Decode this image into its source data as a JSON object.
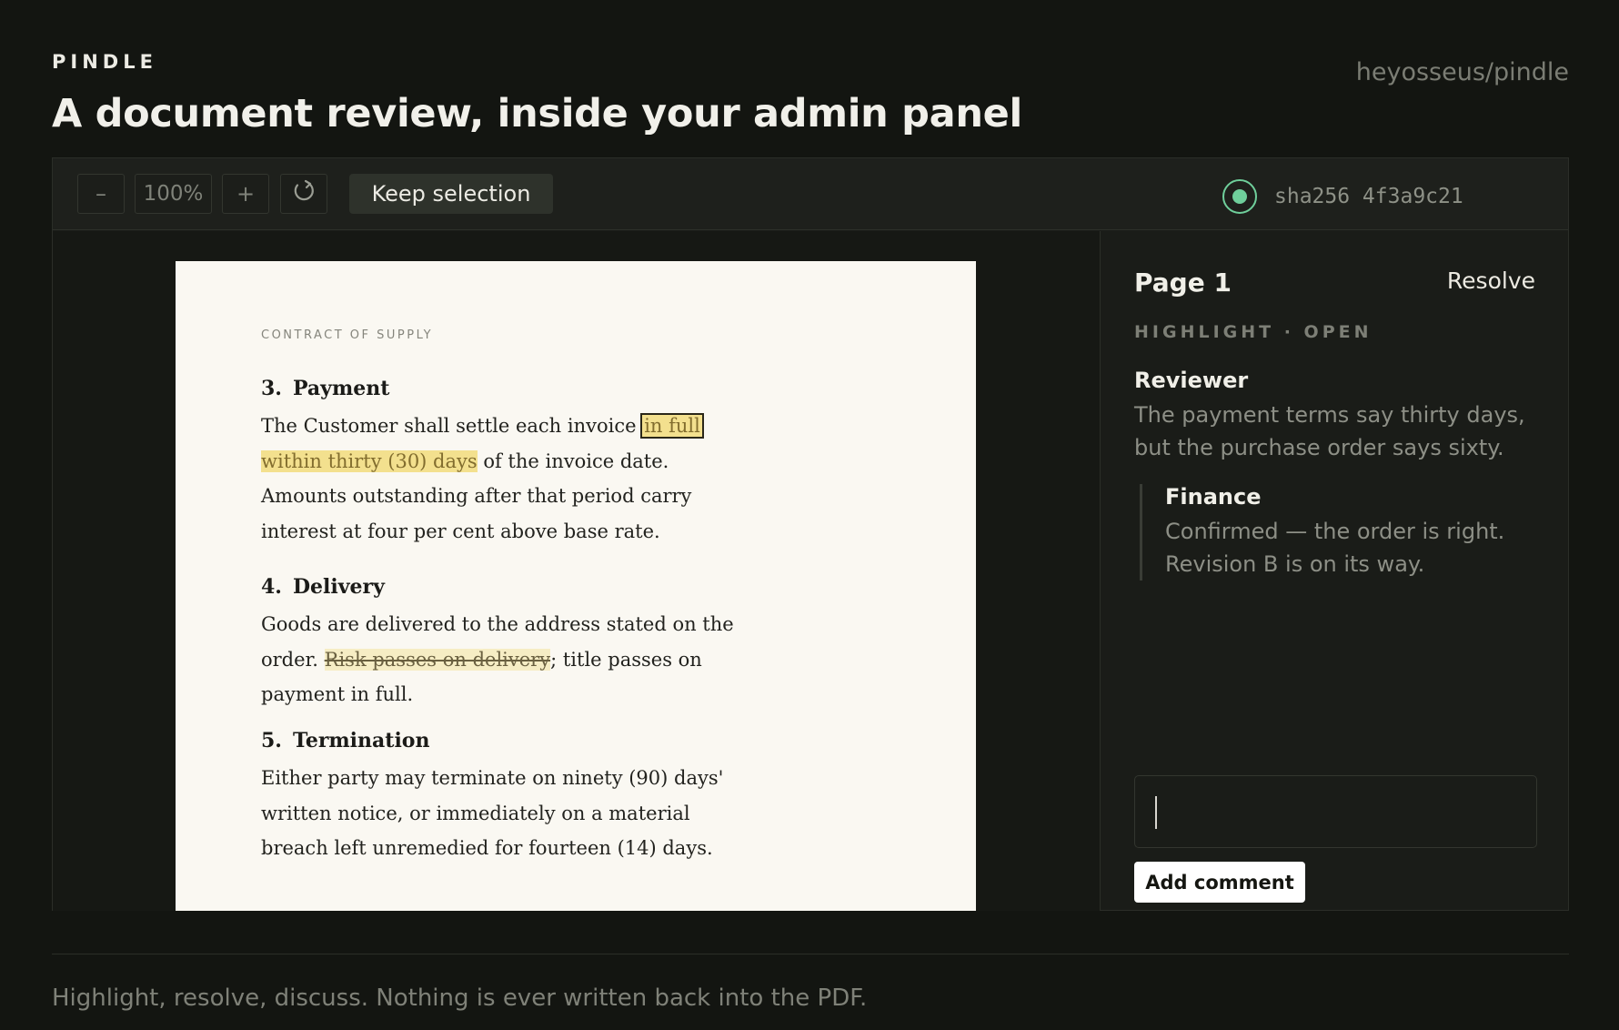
{
  "header": {
    "brand": "PINDLE",
    "headline": "A document review, inside your admin panel",
    "repo": "heyosseus/pindle"
  },
  "toolbar": {
    "zoom_out": "–",
    "zoom_level": "100%",
    "zoom_in": "+",
    "reset_icon": "rotate-icon",
    "keep_selection": "Keep selection",
    "status_color": "#6fcf9b",
    "hash": "sha256 4f3a9c21"
  },
  "document": {
    "kicker": "CONTRACT OF SUPPLY",
    "sections": [
      {
        "num": "3.",
        "title": "Payment",
        "p_before": "The Customer shall settle each invoice ",
        "hl_a": "in full",
        "hl_b": "within thirty (30) days",
        "p_after": " of the invoice date. Amounts outstanding after that period carry interest at four per cent above base rate."
      },
      {
        "num": "4.",
        "title": "Delivery",
        "p_before": "Goods are delivered to the address stated on the order. ",
        "hl_strike": "Risk passes on delivery",
        "p_after": "; title passes on payment in full."
      },
      {
        "num": "5.",
        "title": "Termination",
        "p": "Either party may terminate on ninety (90) days' written notice, or immediately on a material breach left unremedied for fourteen (14) days."
      }
    ],
    "highlight_color": "#f3e08e"
  },
  "sidebar": {
    "title": "Page 1",
    "resolve": "Resolve",
    "meta": "HIGHLIGHT · OPEN",
    "comments": [
      {
        "author": "Reviewer",
        "text": "The payment terms say thirty days, but the purchase order says sixty."
      }
    ],
    "reply": {
      "author": "Finance",
      "text": "Confirmed — the order is right. Revision B is on its way."
    },
    "input_value": "",
    "add_button": "Add comment"
  },
  "footer": {
    "tagline": "Highlight, resolve, discuss. Nothing is ever written back into the PDF."
  }
}
